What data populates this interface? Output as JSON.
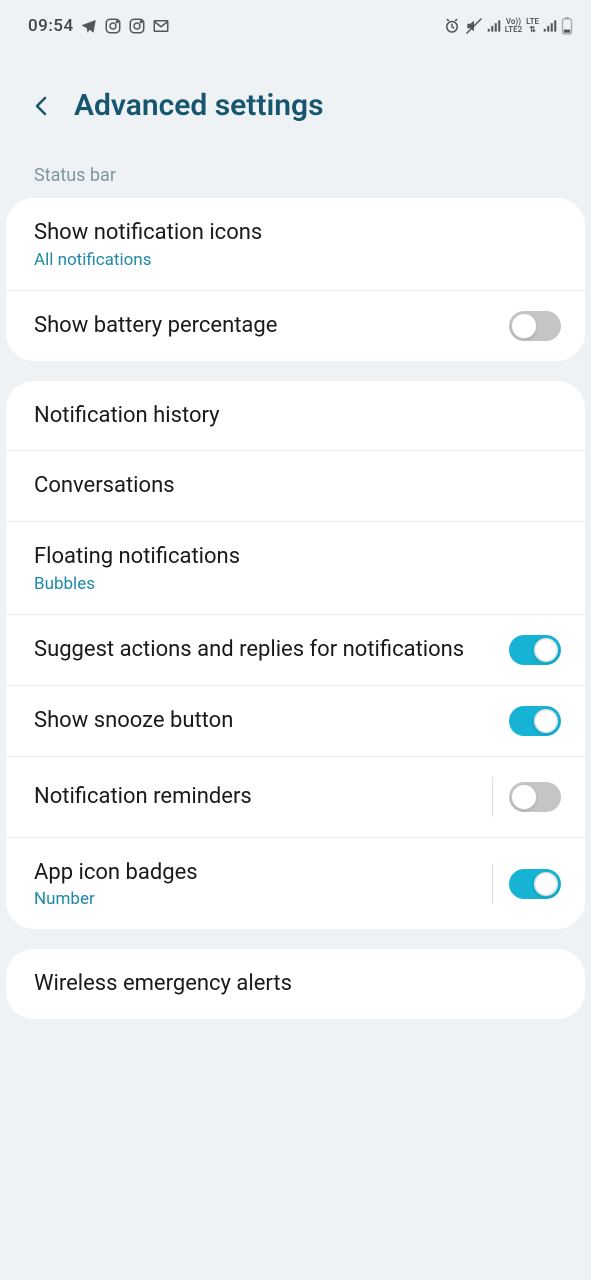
{
  "status": {
    "time": "09:54",
    "sim1_label": "Vo))\nLTE2",
    "sim2_label": "LTE\n⇅"
  },
  "header": {
    "title": "Advanced settings"
  },
  "section1": {
    "label": "Status bar"
  },
  "rows": {
    "show_notif_icons": {
      "title": "Show notification icons",
      "sub": "All notifications"
    },
    "battery_pct": {
      "title": "Show battery percentage"
    },
    "notif_history": {
      "title": "Notification history"
    },
    "conversations": {
      "title": "Conversations"
    },
    "floating": {
      "title": "Floating notifications",
      "sub": "Bubbles"
    },
    "suggest": {
      "title": "Suggest actions and replies for notifications"
    },
    "snooze": {
      "title": "Show snooze button"
    },
    "reminders": {
      "title": "Notification reminders"
    },
    "badges": {
      "title": "App icon badges",
      "sub": "Number"
    },
    "wireless": {
      "title": "Wireless emergency alerts"
    }
  },
  "toggles": {
    "battery_pct": false,
    "suggest": true,
    "snooze": true,
    "reminders": false,
    "badges": true
  }
}
